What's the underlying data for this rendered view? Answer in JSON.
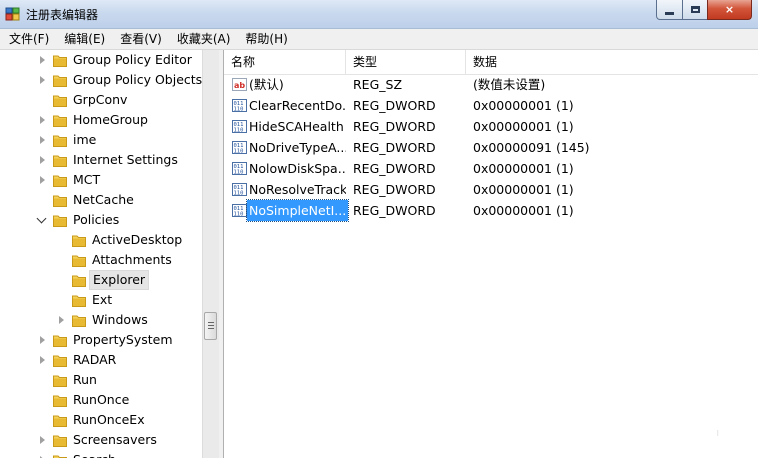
{
  "window": {
    "title": "注册表编辑器",
    "controls": {
      "minimize": "minimize",
      "maximize": "maximize",
      "close": "×"
    }
  },
  "menu": [
    "文件(F)",
    "编辑(E)",
    "查看(V)",
    "收藏夹(A)",
    "帮助(H)"
  ],
  "tree": {
    "items": [
      {
        "label": "Group Policy Editor",
        "level": 0,
        "expander": "closed"
      },
      {
        "label": "Group Policy Objects",
        "level": 0,
        "expander": "closed"
      },
      {
        "label": "GrpConv",
        "level": 0,
        "expander": "none"
      },
      {
        "label": "HomeGroup",
        "level": 0,
        "expander": "closed"
      },
      {
        "label": "ime",
        "level": 0,
        "expander": "closed"
      },
      {
        "label": "Internet Settings",
        "level": 0,
        "expander": "closed"
      },
      {
        "label": "MCT",
        "level": 0,
        "expander": "closed"
      },
      {
        "label": "NetCache",
        "level": 0,
        "expander": "none"
      },
      {
        "label": "Policies",
        "level": 0,
        "expander": "open"
      },
      {
        "label": "ActiveDesktop",
        "level": 1,
        "expander": "none"
      },
      {
        "label": "Attachments",
        "level": 1,
        "expander": "none"
      },
      {
        "label": "Explorer",
        "level": 1,
        "expander": "none",
        "selected": true
      },
      {
        "label": "Ext",
        "level": 1,
        "expander": "none"
      },
      {
        "label": "Windows",
        "level": 1,
        "expander": "closed"
      },
      {
        "label": "PropertySystem",
        "level": 0,
        "expander": "closed"
      },
      {
        "label": "RADAR",
        "level": 0,
        "expander": "closed"
      },
      {
        "label": "Run",
        "level": 0,
        "expander": "none"
      },
      {
        "label": "RunOnce",
        "level": 0,
        "expander": "none"
      },
      {
        "label": "RunOnceEx",
        "level": 0,
        "expander": "none"
      },
      {
        "label": "Screensavers",
        "level": 0,
        "expander": "closed"
      },
      {
        "label": "Search",
        "level": 0,
        "expander": "closed"
      }
    ]
  },
  "list": {
    "columns": [
      "名称",
      "类型",
      "数据"
    ],
    "rows": [
      {
        "name": "(默认)",
        "type": "REG_SZ",
        "data": "(数值未设置)",
        "icon": "string-value-icon"
      },
      {
        "name": "ClearRecentDo...",
        "type": "REG_DWORD",
        "data": "0x00000001 (1)",
        "icon": "dword-value-icon"
      },
      {
        "name": "HideSCAHealth",
        "type": "REG_DWORD",
        "data": "0x00000001 (1)",
        "icon": "dword-value-icon"
      },
      {
        "name": "NoDriveTypeA...",
        "type": "REG_DWORD",
        "data": "0x00000091 (145)",
        "icon": "dword-value-icon"
      },
      {
        "name": "NolowDiskSpa...",
        "type": "REG_DWORD",
        "data": "0x00000001 (1)",
        "icon": "dword-value-icon"
      },
      {
        "name": "NoResolveTrack",
        "type": "REG_DWORD",
        "data": "0x00000001 (1)",
        "icon": "dword-value-icon"
      },
      {
        "name": "NoSimpleNetI...",
        "type": "REG_DWORD",
        "data": "0x00000001 (1)",
        "icon": "dword-value-icon",
        "selected": true
      }
    ]
  },
  "colors": {
    "folder": "#e8b932",
    "selection": "#3399ff",
    "titlebar": "#c9d9ee"
  }
}
